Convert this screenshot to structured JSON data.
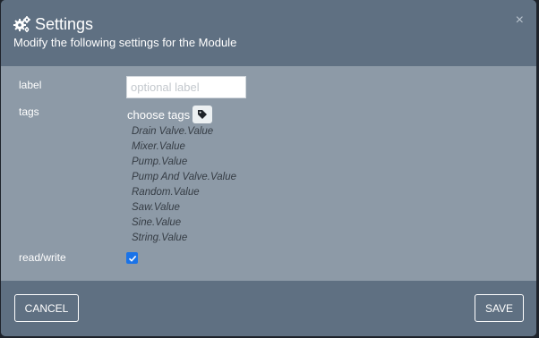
{
  "header": {
    "title": "Settings",
    "subtitle": "Modify the following settings for the Module",
    "close_symbol": "×"
  },
  "form": {
    "label_label": "label",
    "label_value": "",
    "label_placeholder": "optional label",
    "tags_label": "tags",
    "choose_tags": "choose tags",
    "tags": [
      "Drain Valve.Value",
      "Mixer.Value",
      "Pump.Value",
      "Pump And Valve.Value",
      "Random.Value",
      "Saw.Value",
      "Sine.Value",
      "String.Value"
    ],
    "readwrite_label": "read/write",
    "readwrite_checked": true
  },
  "footer": {
    "cancel_label": "CANCEL",
    "save_label": "SAVE"
  },
  "icons": {
    "title_icon": "gears-icon",
    "tag_icon": "tag-icon",
    "checkbox_mark": "checkmark-icon"
  },
  "colors": {
    "header_bg": "#5f7082",
    "body_bg": "#8d9aa7",
    "checkbox_accent": "#1a73e8",
    "tag_text": "#353c44"
  }
}
